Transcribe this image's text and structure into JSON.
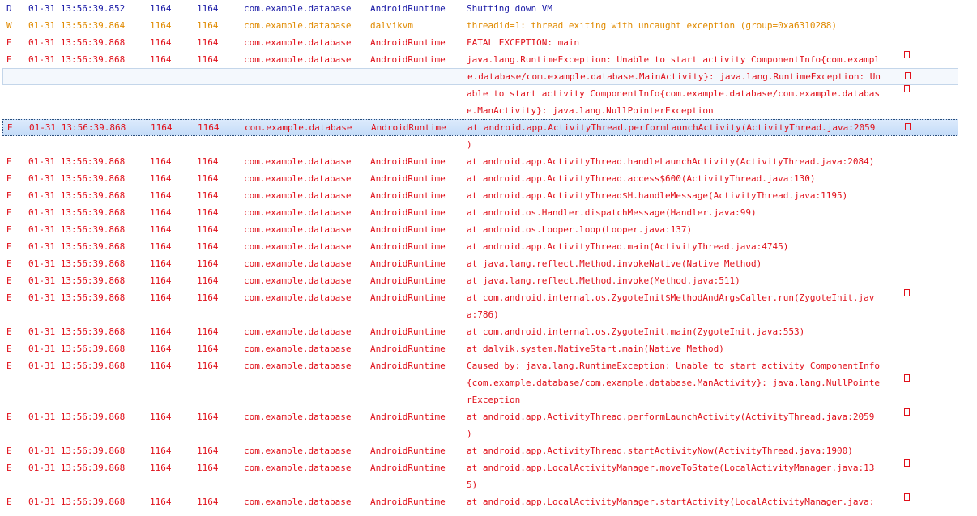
{
  "colors": {
    "debug": "#1a1aa6",
    "warn": "#e08a00",
    "error": "#e0101a",
    "selection_light_bg": "#f4f8fd",
    "selection_dark_bg": "#cfe2fa",
    "selection_border": "#2c4f7c"
  },
  "rows": [
    {
      "level": "D",
      "time": "01-31 13:56:39.852",
      "pid": "1164",
      "tid": "1164",
      "app": "com.example.database",
      "tag": "AndroidRuntime",
      "text": "Shutting down VM",
      "wrap": false
    },
    {
      "level": "W",
      "time": "01-31 13:56:39.864",
      "pid": "1164",
      "tid": "1164",
      "app": "com.example.database",
      "tag": "dalvikvm",
      "text": "threadid=1: thread exiting with uncaught exception (group=0xa6310288)",
      "wrap": false
    },
    {
      "level": "E",
      "time": "01-31 13:56:39.868",
      "pid": "1164",
      "tid": "1164",
      "app": "com.example.database",
      "tag": "AndroidRuntime",
      "text": "FATAL EXCEPTION: main",
      "wrap": false
    },
    {
      "level": "E",
      "time": "01-31 13:56:39.868",
      "pid": "1164",
      "tid": "1164",
      "app": "com.example.database",
      "tag": "AndroidRuntime",
      "text": "java.lang.RuntimeException: Unable to start activity ComponentInfo{com.exampl",
      "wrap": true
    },
    {
      "level": "",
      "time": "",
      "pid": "",
      "tid": "",
      "app": "",
      "tag": "",
      "text": "e.database/com.example.database.MainActivity}: java.lang.RuntimeException: Un",
      "wrap": true,
      "cont_of": "E",
      "selected": "light"
    },
    {
      "level": "",
      "time": "",
      "pid": "",
      "tid": "",
      "app": "",
      "tag": "",
      "text": "able to start activity ComponentInfo{com.example.database/com.example.databas",
      "wrap": true,
      "cont_of": "E"
    },
    {
      "level": "",
      "time": "",
      "pid": "",
      "tid": "",
      "app": "",
      "tag": "",
      "text": "e.ManActivity}: java.lang.NullPointerException",
      "wrap": false,
      "cont_of": "E"
    },
    {
      "level": "E",
      "time": "01-31 13:56:39.868",
      "pid": "1164",
      "tid": "1164",
      "app": "com.example.database",
      "tag": "AndroidRuntime",
      "text": "at android.app.ActivityThread.performLaunchActivity(ActivityThread.java:2059",
      "wrap": true,
      "selected": "dark"
    },
    {
      "level": "",
      "time": "",
      "pid": "",
      "tid": "",
      "app": "",
      "tag": "",
      "text": ")",
      "wrap": false,
      "cont_of": "E"
    },
    {
      "level": "E",
      "time": "01-31 13:56:39.868",
      "pid": "1164",
      "tid": "1164",
      "app": "com.example.database",
      "tag": "AndroidRuntime",
      "text": "at android.app.ActivityThread.handleLaunchActivity(ActivityThread.java:2084)",
      "wrap": false
    },
    {
      "level": "E",
      "time": "01-31 13:56:39.868",
      "pid": "1164",
      "tid": "1164",
      "app": "com.example.database",
      "tag": "AndroidRuntime",
      "text": "at android.app.ActivityThread.access$600(ActivityThread.java:130)",
      "wrap": false
    },
    {
      "level": "E",
      "time": "01-31 13:56:39.868",
      "pid": "1164",
      "tid": "1164",
      "app": "com.example.database",
      "tag": "AndroidRuntime",
      "text": "at android.app.ActivityThread$H.handleMessage(ActivityThread.java:1195)",
      "wrap": false
    },
    {
      "level": "E",
      "time": "01-31 13:56:39.868",
      "pid": "1164",
      "tid": "1164",
      "app": "com.example.database",
      "tag": "AndroidRuntime",
      "text": "at android.os.Handler.dispatchMessage(Handler.java:99)",
      "wrap": false
    },
    {
      "level": "E",
      "time": "01-31 13:56:39.868",
      "pid": "1164",
      "tid": "1164",
      "app": "com.example.database",
      "tag": "AndroidRuntime",
      "text": "at android.os.Looper.loop(Looper.java:137)",
      "wrap": false
    },
    {
      "level": "E",
      "time": "01-31 13:56:39.868",
      "pid": "1164",
      "tid": "1164",
      "app": "com.example.database",
      "tag": "AndroidRuntime",
      "text": "at android.app.ActivityThread.main(ActivityThread.java:4745)",
      "wrap": false
    },
    {
      "level": "E",
      "time": "01-31 13:56:39.868",
      "pid": "1164",
      "tid": "1164",
      "app": "com.example.database",
      "tag": "AndroidRuntime",
      "text": "at java.lang.reflect.Method.invokeNative(Native Method)",
      "wrap": false
    },
    {
      "level": "E",
      "time": "01-31 13:56:39.868",
      "pid": "1164",
      "tid": "1164",
      "app": "com.example.database",
      "tag": "AndroidRuntime",
      "text": "at java.lang.reflect.Method.invoke(Method.java:511)",
      "wrap": false
    },
    {
      "level": "E",
      "time": "01-31 13:56:39.868",
      "pid": "1164",
      "tid": "1164",
      "app": "com.example.database",
      "tag": "AndroidRuntime",
      "text": "at com.android.internal.os.ZygoteInit$MethodAndArgsCaller.run(ZygoteInit.jav",
      "wrap": true
    },
    {
      "level": "",
      "time": "",
      "pid": "",
      "tid": "",
      "app": "",
      "tag": "",
      "text": "a:786)",
      "wrap": false,
      "cont_of": "E"
    },
    {
      "level": "E",
      "time": "01-31 13:56:39.868",
      "pid": "1164",
      "tid": "1164",
      "app": "com.example.database",
      "tag": "AndroidRuntime",
      "text": "at com.android.internal.os.ZygoteInit.main(ZygoteInit.java:553)",
      "wrap": false
    },
    {
      "level": "E",
      "time": "01-31 13:56:39.868",
      "pid": "1164",
      "tid": "1164",
      "app": "com.example.database",
      "tag": "AndroidRuntime",
      "text": "at dalvik.system.NativeStart.main(Native Method)",
      "wrap": false
    },
    {
      "level": "E",
      "time": "01-31 13:56:39.868",
      "pid": "1164",
      "tid": "1164",
      "app": "com.example.database",
      "tag": "AndroidRuntime",
      "text": "Caused by: java.lang.RuntimeException: Unable to start activity ComponentInfo",
      "wrap": false
    },
    {
      "level": "",
      "time": "",
      "pid": "",
      "tid": "",
      "app": "",
      "tag": "",
      "text": "{com.example.database/com.example.database.ManActivity}: java.lang.NullPointe",
      "wrap": true,
      "cont_of": "E"
    },
    {
      "level": "",
      "time": "",
      "pid": "",
      "tid": "",
      "app": "",
      "tag": "",
      "text": "rException",
      "wrap": false,
      "cont_of": "E"
    },
    {
      "level": "E",
      "time": "01-31 13:56:39.868",
      "pid": "1164",
      "tid": "1164",
      "app": "com.example.database",
      "tag": "AndroidRuntime",
      "text": "at android.app.ActivityThread.performLaunchActivity(ActivityThread.java:2059",
      "wrap": true
    },
    {
      "level": "",
      "time": "",
      "pid": "",
      "tid": "",
      "app": "",
      "tag": "",
      "text": ")",
      "wrap": false,
      "cont_of": "E"
    },
    {
      "level": "E",
      "time": "01-31 13:56:39.868",
      "pid": "1164",
      "tid": "1164",
      "app": "com.example.database",
      "tag": "AndroidRuntime",
      "text": "at android.app.ActivityThread.startActivityNow(ActivityThread.java:1900)",
      "wrap": false
    },
    {
      "level": "E",
      "time": "01-31 13:56:39.868",
      "pid": "1164",
      "tid": "1164",
      "app": "com.example.database",
      "tag": "AndroidRuntime",
      "text": "at android.app.LocalActivityManager.moveToState(LocalActivityManager.java:13",
      "wrap": true
    },
    {
      "level": "",
      "time": "",
      "pid": "",
      "tid": "",
      "app": "",
      "tag": "",
      "text": "5)",
      "wrap": false,
      "cont_of": "E"
    },
    {
      "level": "E",
      "time": "01-31 13:56:39.868",
      "pid": "1164",
      "tid": "1164",
      "app": "com.example.database",
      "tag": "AndroidRuntime",
      "text": "at android.app.LocalActivityManager.startActivity(LocalActivityManager.java:",
      "wrap": true
    }
  ]
}
